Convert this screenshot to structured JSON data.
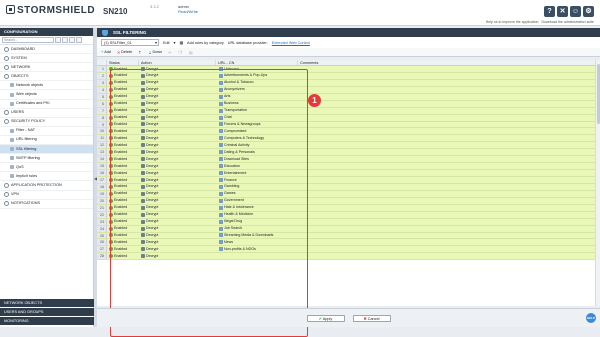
{
  "header": {
    "brand": "STORMSHIELD",
    "model": "SN210",
    "version_top": "",
    "version": "3.3.2",
    "user": "admin",
    "user_access": "Read/Write",
    "icons": [
      "help-icon",
      "close-icon",
      "user-icon",
      "settings-icon"
    ],
    "links": [
      "Help us to improve the application",
      "Download the administration suite"
    ]
  },
  "sidebar": {
    "title": "CONFIGURATION",
    "search_placeholder": "Search...",
    "items": [
      {
        "label": "DASHBOARD",
        "type": "cat"
      },
      {
        "label": "SYSTEM",
        "type": "cat"
      },
      {
        "label": "NETWORK",
        "type": "cat"
      },
      {
        "label": "OBJECTS",
        "type": "cat"
      },
      {
        "label": "Network objects",
        "type": "sub"
      },
      {
        "label": "Web objects",
        "type": "sub"
      },
      {
        "label": "Certificates and PKI",
        "type": "sub"
      },
      {
        "label": "USERS",
        "type": "cat"
      },
      {
        "label": "SECURITY POLICY",
        "type": "cat"
      },
      {
        "label": "Filter - NAT",
        "type": "sub"
      },
      {
        "label": "URL filtering",
        "type": "sub"
      },
      {
        "label": "SSL filtering",
        "type": "sub",
        "active": true
      },
      {
        "label": "SMTP filtering",
        "type": "sub"
      },
      {
        "label": "QoS",
        "type": "sub"
      },
      {
        "label": "Implicit rules",
        "type": "sub"
      },
      {
        "label": "APPLICATION PROTECTION",
        "type": "cat"
      },
      {
        "label": "VPN",
        "type": "cat"
      },
      {
        "label": "NOTIFICATIONS",
        "type": "cat"
      }
    ],
    "footer": [
      "NETWORK OBJECTS",
      "USERS AND GROUPS",
      "MONITORING"
    ]
  },
  "panel": {
    "title": "SSL FILTERING",
    "profile": "(1) SSLFilter_01",
    "edit": "Edit",
    "add_rules": "Add rules by category",
    "url_db_label": "URL database provider:",
    "url_db_link": "Extended Web Control",
    "toolbar": {
      "add": "Add",
      "delete": "Delete",
      "up": "",
      "down": "Down",
      "cut": "",
      "copy": "",
      "paste": ""
    },
    "columns": [
      "Status",
      "Action",
      "URL - CN",
      "Comments"
    ],
    "rows": [
      {
        "n": "1",
        "status": "Enabled",
        "action": "Decrypt",
        "url": "Unknown"
      },
      {
        "n": "2",
        "status": "Enabled",
        "action": "Decrypt",
        "url": "Advertisements & Pop-Ups"
      },
      {
        "n": "3",
        "status": "Enabled",
        "action": "Decrypt",
        "url": "Alcohol & Tobacco"
      },
      {
        "n": "4",
        "status": "Enabled",
        "action": "Decrypt",
        "url": "Anonymizers"
      },
      {
        "n": "5",
        "status": "Enabled",
        "action": "Decrypt",
        "url": "Arts"
      },
      {
        "n": "6",
        "status": "Enabled",
        "action": "Decrypt",
        "url": "Business"
      },
      {
        "n": "7",
        "status": "Enabled",
        "action": "Decrypt",
        "url": "Transportation"
      },
      {
        "n": "8",
        "status": "Enabled",
        "action": "Decrypt",
        "url": "Chat"
      },
      {
        "n": "9",
        "status": "Enabled",
        "action": "Decrypt",
        "url": "Forums & Newsgroups"
      },
      {
        "n": "10",
        "status": "Enabled",
        "action": "Decrypt",
        "url": "Compromised"
      },
      {
        "n": "11",
        "status": "Enabled",
        "action": "Decrypt",
        "url": "Computers & Technology"
      },
      {
        "n": "12",
        "status": "Enabled",
        "action": "Decrypt",
        "url": "Criminal Activity"
      },
      {
        "n": "13",
        "status": "Enabled",
        "action": "Decrypt",
        "url": "Dating & Personals"
      },
      {
        "n": "14",
        "status": "Enabled",
        "action": "Decrypt",
        "url": "Download Sites"
      },
      {
        "n": "15",
        "status": "Enabled",
        "action": "Decrypt",
        "url": "Education"
      },
      {
        "n": "16",
        "status": "Enabled",
        "action": "Decrypt",
        "url": "Entertainment"
      },
      {
        "n": "17",
        "status": "Enabled",
        "action": "Decrypt",
        "url": "Finance"
      },
      {
        "n": "18",
        "status": "Enabled",
        "action": "Decrypt",
        "url": "Gambling"
      },
      {
        "n": "19",
        "status": "Enabled",
        "action": "Decrypt",
        "url": "Games"
      },
      {
        "n": "20",
        "status": "Enabled",
        "action": "Decrypt",
        "url": "Government"
      },
      {
        "n": "21",
        "status": "Enabled",
        "action": "Decrypt",
        "url": "Hate & Intolerance"
      },
      {
        "n": "22",
        "status": "Enabled",
        "action": "Decrypt",
        "url": "Health & Medicine"
      },
      {
        "n": "23",
        "status": "Enabled",
        "action": "Decrypt",
        "url": "Illegal Drug"
      },
      {
        "n": "24",
        "status": "Enabled",
        "action": "Decrypt",
        "url": "Job Search"
      },
      {
        "n": "25",
        "status": "Enabled",
        "action": "Decrypt",
        "url": "Streaming Media & Downloads"
      },
      {
        "n": "26",
        "status": "Enabled",
        "action": "Decrypt",
        "url": "News"
      },
      {
        "n": "27",
        "status": "Enabled",
        "action": "Decrypt",
        "url": "Non-profits & NGOs"
      },
      {
        "n": "28",
        "status": "Enabled",
        "action": "Decrypt",
        "url": ""
      }
    ],
    "apply": "Apply",
    "cancel": "Cancel",
    "annotation": "1",
    "help_btn": "HELP"
  },
  "colors": {
    "row_bg": "#e9f7b7",
    "header_bg": "#2f3d4c",
    "enabled_dot": "#4bb33b",
    "highlight": "#e33a3a"
  }
}
